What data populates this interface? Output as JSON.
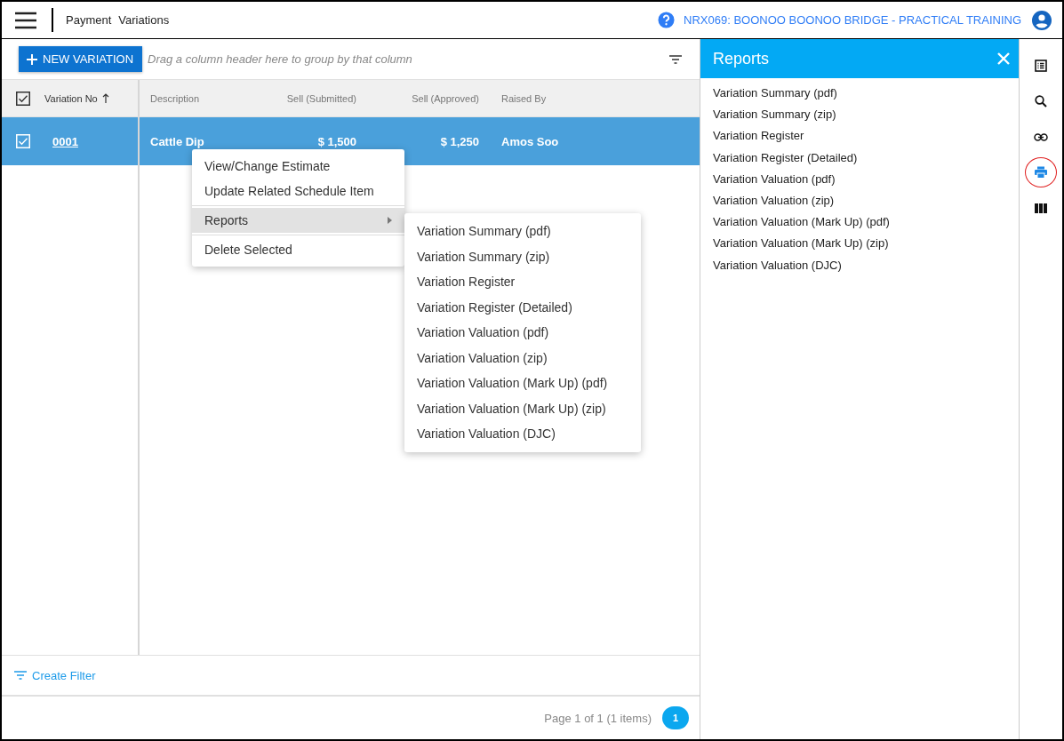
{
  "header": {
    "breadcrumb": [
      "Payment",
      "Variations"
    ],
    "project": "NRX069: BOONOO BOONOO BRIDGE - PRACTICAL TRAINING"
  },
  "toolbar": {
    "new_button": "NEW VARIATION",
    "group_hint": "Drag a column header here to group by that column"
  },
  "table": {
    "all_checked": true,
    "columns": [
      {
        "label": "Variation No",
        "sorted": true
      },
      {
        "label": "Description",
        "sorted": false
      },
      {
        "label": "Sell (Submitted)",
        "sorted": false
      },
      {
        "label": "Sell (Approved)",
        "sorted": false
      },
      {
        "label": "Raised By",
        "sorted": false
      }
    ],
    "rows": [
      {
        "selected": true,
        "checked": true,
        "cells": [
          "0001",
          "Cattle Dip",
          "$ 1,500",
          "$ 1,250",
          "Amos Soo"
        ]
      }
    ]
  },
  "context_menu": {
    "groups": [
      [
        {
          "label": "View/Change Estimate",
          "selected": false,
          "submenu": false
        },
        {
          "label": "Update Related Schedule Item",
          "selected": false,
          "submenu": false
        }
      ],
      [
        {
          "label": "Reports",
          "selected": true,
          "submenu": true
        }
      ],
      [
        {
          "label": "Delete Selected",
          "selected": false,
          "submenu": false
        }
      ]
    ]
  },
  "submenu": {
    "items": [
      "Variation Summary (pdf)",
      "Variation Summary (zip)",
      "Variation Register",
      "Variation Register (Detailed)",
      "Variation Valuation (pdf)",
      "Variation Valuation (zip)",
      "Variation Valuation (Mark Up) (pdf)",
      "Variation Valuation (Mark Up) (zip)",
      "Variation Valuation (DJC)"
    ]
  },
  "reports_panel": {
    "title": "Reports",
    "items": [
      "Variation Summary (pdf)",
      "Variation Summary (zip)",
      "Variation Register",
      "Variation Register (Detailed)",
      "Variation Valuation (pdf)",
      "Variation Valuation (zip)",
      "Variation Valuation (Mark Up) (pdf)",
      "Variation Valuation (Mark Up) (zip)",
      "Variation Valuation (DJC)"
    ]
  },
  "rail": [
    {
      "kind": "list",
      "selected": false
    },
    {
      "kind": "search",
      "selected": false
    },
    {
      "kind": "link",
      "selected": false
    },
    {
      "kind": "print",
      "selected": true
    },
    {
      "kind": "columns",
      "selected": false
    }
  ],
  "footer": {
    "filter_link": "Create Filter",
    "paging": "Page 1 of 1 (1 items)",
    "pages": [
      {
        "label": "1",
        "selected": true
      }
    ]
  }
}
